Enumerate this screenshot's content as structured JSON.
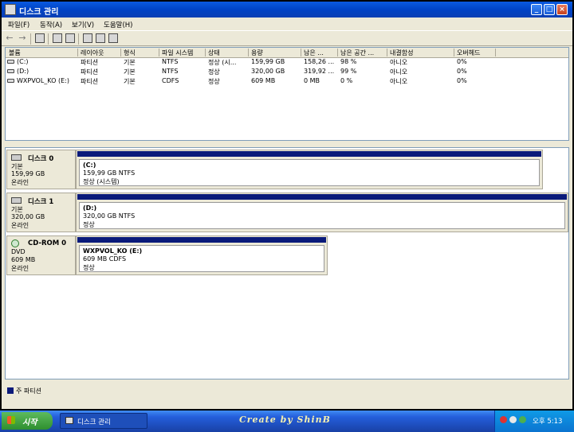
{
  "window": {
    "title": "디스크 관리"
  },
  "menu": [
    "파일(F)",
    "동작(A)",
    "보기(V)",
    "도움말(H)"
  ],
  "volume_list": {
    "columns": [
      "볼륨",
      "레이아웃",
      "형식",
      "파일 시스템",
      "상태",
      "용량",
      "남은 ...",
      "남은 공간 ...",
      "내결함성",
      "오버헤드"
    ],
    "rows": [
      [
        "(C:)",
        "파티션",
        "기본",
        "NTFS",
        "정상 (시...",
        "159,99 GB",
        "158,26 ...",
        "98 %",
        "아니오",
        "0%"
      ],
      [
        "(D:)",
        "파티션",
        "기본",
        "NTFS",
        "정상",
        "320,00 GB",
        "319,92 ...",
        "99 %",
        "아니오",
        "0%"
      ],
      [
        "WXPVOL_KO (E:)",
        "파티션",
        "기본",
        "CDFS",
        "정상",
        "609 MB",
        "0 MB",
        "0 %",
        "아니오",
        "0%"
      ]
    ]
  },
  "disks": [
    {
      "name": "디스크 0",
      "type": "기본",
      "size": "159,99 GB",
      "status": "온라인",
      "partition": {
        "name": "(C:)",
        "size_fs": "159,99 GB NTFS",
        "status": "정상 (시스템)"
      }
    },
    {
      "name": "디스크 1",
      "type": "기본",
      "size": "320,00 GB",
      "status": "온라인",
      "partition": {
        "name": "(D:)",
        "size_fs": "320,00 GB NTFS",
        "status": "정상"
      }
    },
    {
      "name": "CD-ROM 0",
      "type": "DVD",
      "size": "609 MB",
      "status": "온라인",
      "partition": {
        "name": "WXPVOL_KO  (E:)",
        "size_fs": "609 MB CDFS",
        "status": "정상"
      }
    }
  ],
  "legend": {
    "primary_partition": "주 파티션",
    "color": "#0a1a7a"
  },
  "taskbar": {
    "start_label": "시작",
    "task_label": "디스크 관리",
    "watermark": "Create by ShinB",
    "clock": "오후 5:13"
  }
}
